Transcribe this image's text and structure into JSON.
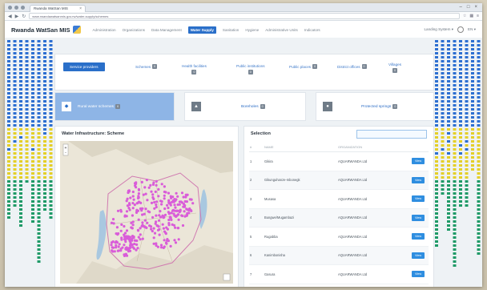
{
  "browser": {
    "tab_title": "Rwanda WatSan MIS",
    "tab_close": "×",
    "url": "www.rwandawatsanmis.gov.rw/water-supply/schemes",
    "window_controls": [
      "–",
      "□",
      "×"
    ]
  },
  "app": {
    "brand": "Rwanda WatSan MIS",
    "menu": [
      "Administration",
      "Organizations",
      "Data Management",
      "Water Supply",
      "Sanitation",
      "Hygiene",
      "Administrative Units",
      "Indicators"
    ],
    "active_menu": "Water Supply",
    "user_menu": "Landing System ▾",
    "lang": "EN ▾"
  },
  "filters": [
    {
      "label": "Service providers",
      "badge": ""
    },
    {
      "label": "Schemes",
      "badge": "0"
    },
    {
      "label": "Health facilities",
      "badge": "0"
    },
    {
      "label": "Public institutions",
      "badge": "0"
    },
    {
      "label": "Public places",
      "badge": "0"
    },
    {
      "label": "District offices",
      "badge": "0"
    },
    {
      "label": "Villages",
      "badge": "0"
    }
  ],
  "tiles": [
    {
      "label": "Rural water schemes",
      "badge": "0",
      "icon": "tap-icon"
    },
    {
      "label": "Boreholes",
      "badge": "0",
      "icon": "well-icon"
    },
    {
      "label": "Protected springs",
      "badge": "0",
      "icon": "spring-icon"
    }
  ],
  "map_panel": {
    "title": "Water Infrastructure: Scheme"
  },
  "selection_panel": {
    "title": "Selection",
    "search_placeholder": "",
    "columns": [
      "#",
      "NAME",
      "ORGANIZATION",
      ""
    ],
    "rows": [
      {
        "idx": "1",
        "name": "Gikira",
        "org": "AQUARWANDA Ltd",
        "action": "View"
      },
      {
        "idx": "2",
        "name": "Gikunguhanze-mbonegk",
        "org": "AQUARWANDA Ltd",
        "action": "View"
      },
      {
        "idx": "3",
        "name": "Musasa",
        "org": "AQUARWANDA Ltd",
        "action": "View"
      },
      {
        "idx": "4",
        "name": "Bungwe/Mugambazi",
        "org": "AQUARWANDA Ltd",
        "action": "View"
      },
      {
        "idx": "5",
        "name": "Rugabba",
        "org": "AQUARWANDA Ltd",
        "action": "View"
      },
      {
        "idx": "6",
        "name": "Kanimbonisha",
        "org": "AQUARWANDA Ltd",
        "action": "View"
      },
      {
        "idx": "7",
        "name": "Gasura",
        "org": "AQUARWANDA Ltd",
        "action": "View"
      }
    ]
  },
  "colors": {
    "primary": "#2a6fc9",
    "marker": "#d95cd9",
    "dots_blue": "#2d6fd1",
    "dots_yellow": "#e4cf28",
    "dots_green": "#1f9a67"
  }
}
